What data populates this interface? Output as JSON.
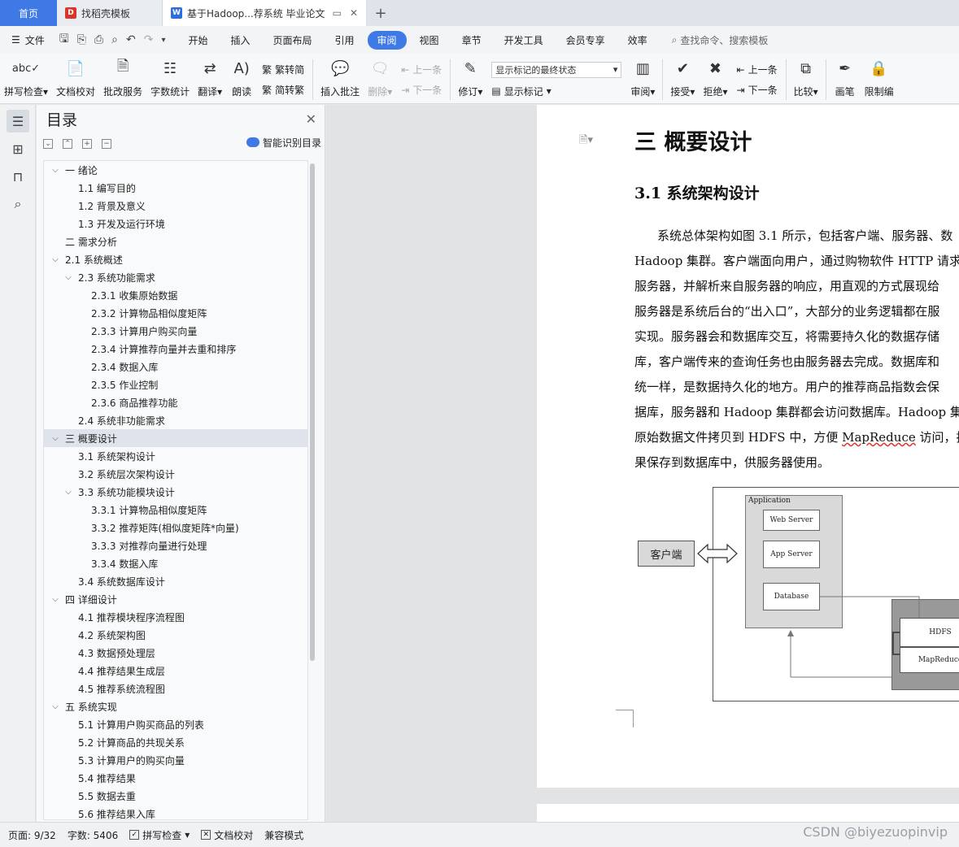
{
  "tabs": {
    "home": "首页",
    "template": "找稻壳模板",
    "document": "基于Hadoop...荐系统 毕业论文",
    "template_icon": "daoke-icon",
    "document_icon": "wps-writer-icon"
  },
  "menu": {
    "file": "文件",
    "items": [
      "开始",
      "插入",
      "页面布局",
      "引用",
      "审阅",
      "视图",
      "章节",
      "开发工具",
      "会员专享",
      "效率"
    ],
    "active": "审阅",
    "search": "查找命令、搜索模板"
  },
  "ribbon": {
    "spell_check": "拼写检查",
    "doc_proof": "文档校对",
    "annotate_service": "批改服务",
    "word_count": "字数统计",
    "translate": "翻译",
    "read_aloud": "朗读",
    "trad_to_simp": "繁转简",
    "simp_to_trad": "简转繁",
    "insert_comment": "插入批注",
    "delete": "删除",
    "prev_comment": "上一条",
    "next_comment": "下一条",
    "track_changes": "修订",
    "markup_state": "显示标记的最终状态",
    "show_markup": "显示标记",
    "review": "审阅",
    "accept": "接受",
    "reject": "拒绝",
    "prev_change": "上一条",
    "next_change": "下一条",
    "compare": "比较",
    "pen": "画笔",
    "restrict_edit": "限制编"
  },
  "toc": {
    "title": "目录",
    "smart": "智能识别目录",
    "items": [
      {
        "t": "一  绪论",
        "lvl": 0,
        "chev": "v"
      },
      {
        "t": "1.1  编写目的",
        "lvl": 1
      },
      {
        "t": "1.2  背景及意义",
        "lvl": 1
      },
      {
        "t": "1.3  开发及运行环境",
        "lvl": 1
      },
      {
        "t": "二  需求分析",
        "lvl": 0
      },
      {
        "t": "2.1  系统概述",
        "lvl": 0,
        "chev": "v"
      },
      {
        "t": "2.3  系统功能需求",
        "lvl": 1,
        "chev": "v"
      },
      {
        "t": "2.3.1  收集原始数据",
        "lvl": 2
      },
      {
        "t": "2.3.2  计算物品相似度矩阵",
        "lvl": 2
      },
      {
        "t": "2.3.3  计算用户购买向量",
        "lvl": 2
      },
      {
        "t": "2.3.4  计算推荐向量并去重和排序",
        "lvl": 2
      },
      {
        "t": "2.3.4  数据入库",
        "lvl": 2
      },
      {
        "t": "2.3.5  作业控制",
        "lvl": 2
      },
      {
        "t": "2.3.6 商品推荐功能",
        "lvl": 2
      },
      {
        "t": "2.4  系统非功能需求",
        "lvl": 1
      },
      {
        "t": "三  概要设计",
        "lvl": 0,
        "chev": "v",
        "sel": true
      },
      {
        "t": "3.1 系统架构设计",
        "lvl": 1
      },
      {
        "t": "3.2 系统层次架构设计",
        "lvl": 1
      },
      {
        "t": "3.3 系统功能模块设计",
        "lvl": 1,
        "chev": "v"
      },
      {
        "t": "3.3.1  计算物品相似度矩阵",
        "lvl": 2
      },
      {
        "t": "3.3.2 推荐矩阵(相似度矩阵*向量)",
        "lvl": 2
      },
      {
        "t": "3.3.3 对推荐向量进行处理",
        "lvl": 2
      },
      {
        "t": "3.3.4 数据入库",
        "lvl": 2
      },
      {
        "t": "3.4 系统数据库设计",
        "lvl": 1
      },
      {
        "t": "四  详细设计",
        "lvl": 0,
        "chev": "v"
      },
      {
        "t": "4.1 推荐模块程序流程图",
        "lvl": 1
      },
      {
        "t": "4.2 系统架构图",
        "lvl": 1
      },
      {
        "t": "4.3 数据预处理层",
        "lvl": 1
      },
      {
        "t": "4.4 推荐结果生成层",
        "lvl": 1
      },
      {
        "t": "4.5 推荐系统流程图",
        "lvl": 1
      },
      {
        "t": "五  系统实现",
        "lvl": 0,
        "chev": "v"
      },
      {
        "t": "5.1 计算用户购买商品的列表",
        "lvl": 1
      },
      {
        "t": "5.2 计算商品的共现关系",
        "lvl": 1
      },
      {
        "t": "5.3 计算用户的购买向量",
        "lvl": 1
      },
      {
        "t": "5.4 推荐结果",
        "lvl": 1
      },
      {
        "t": "5.5 数据去重",
        "lvl": 1
      },
      {
        "t": "5.6 推荐结果入库",
        "lvl": 1
      }
    ]
  },
  "doc": {
    "heading1": "三  概要设计",
    "heading2": "3.1 系统架构设计",
    "lines": [
      "系统总体架构如图 3.1 所示，包括客户端、服务器、数",
      "Hadoop 集群。客户端面向用户，通过购物软件 HTTP 请求",
      "服务器，并解析来自服务器的响应，用直观的方式展现给",
      "服务器是系统后台的“出入口”，大部分的业务逻辑都在服",
      "实现。服务器会和数据库交互，将需要持久化的数据存储",
      "库，客户端传来的查询任务也由服务器去完成。数据库和",
      "统一样，是数据持久化的地方。用户的推荐商品指数会保",
      "据库，服务器和 Hadoop 集群都会访问数据库。Hadoop 集",
      "原始数据文件拷贝到 HDFS 中，方便 ",
      "果保存到数据库中，供服务器使用。"
    ],
    "line9_underlined": "MapReduce",
    "line9_tail": " 访问，执",
    "diagram": {
      "client": "客户端",
      "application": "Application",
      "web_server": "Web Server",
      "app_server": "App Server",
      "database": "Database",
      "hdfs": "HDFS",
      "mapreduce": "MapReduce"
    }
  },
  "status": {
    "page": "页面: 9/32",
    "words": "字数: 5406",
    "spell": "拼写检查",
    "proof": "文档校对",
    "compat": "兼容模式"
  },
  "watermark": "CSDN @biyezuopinvip"
}
